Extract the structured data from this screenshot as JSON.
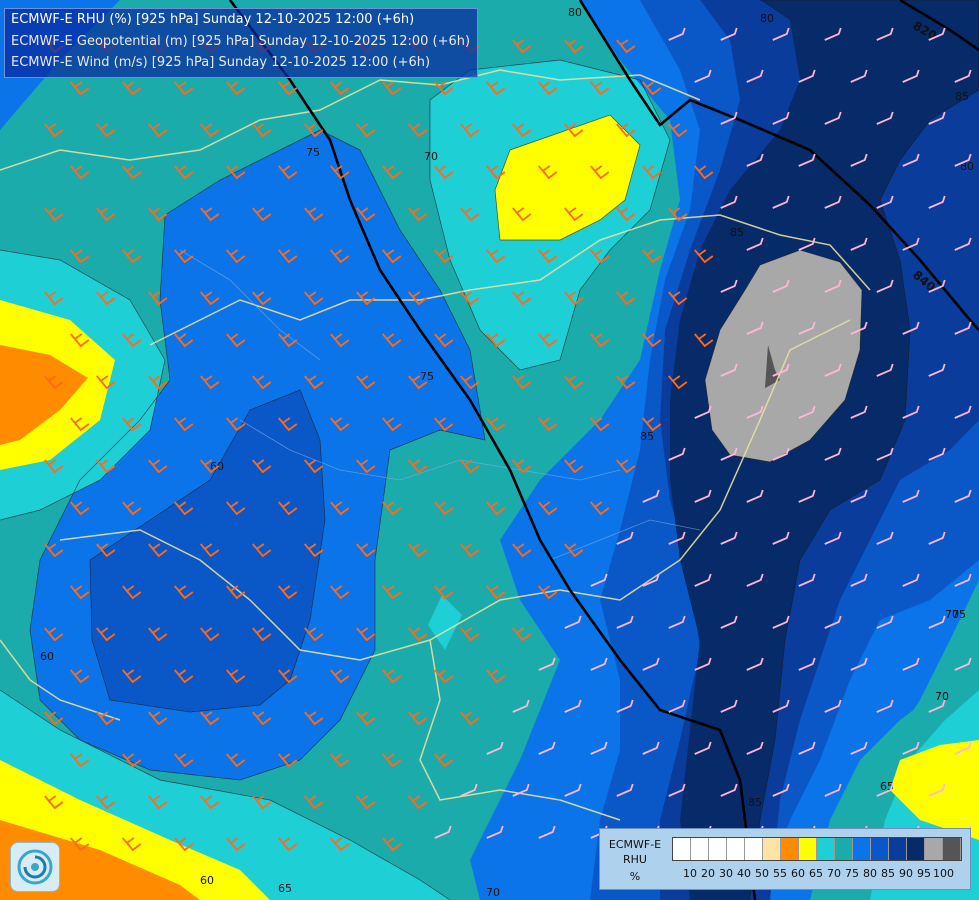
{
  "titles": [
    "ECMWF-E RHU (%) [925 hPa] Sunday 12-10-2025 12:00 (+6h)",
    "ECMWF-E Geopotential (m) [925 hPa] Sunday 12-10-2025 12:00 (+6h)",
    "ECMWF-E Wind (m/s) [925 hPa] Sunday 12-10-2025 12:00 (+6h)"
  ],
  "legend": {
    "title_lines": [
      "ECMWF-E",
      "RHU",
      "%"
    ],
    "colors": [
      "#ffffff",
      "#ffffff",
      "#ffffff",
      "#ffffff",
      "#ffffff",
      "#fde3a4",
      "#ff8c00",
      "#ffff00",
      "#1fcfd6",
      "#1aabaa",
      "#0a74e8",
      "#0a58c8",
      "#0a3c9c",
      "#072a68",
      "#a8a8a8",
      "#555555"
    ],
    "ticks": [
      "10",
      "20",
      "30",
      "40",
      "50",
      "55",
      "60",
      "65",
      "70",
      "75",
      "80",
      "85",
      "90",
      "95",
      "100"
    ]
  },
  "contour_labels": [
    "80",
    "80",
    "85",
    "75",
    "70",
    "70",
    "80",
    "85",
    "60",
    "60",
    "75",
    "70",
    "65",
    "60",
    "65",
    "70",
    "85",
    "85",
    "75"
  ],
  "geopotential_labels": [
    "820",
    "840"
  ],
  "colors": {
    "rh_55": "#fde3a4",
    "rh_60": "#ff8c00",
    "rh_65": "#ffff00",
    "rh_70": "#1fcfd6",
    "rh_75": "#1aabaa",
    "rh_80": "#0a74e8",
    "rh_85": "#0a58c8",
    "rh_90": "#0a3c9c",
    "rh_95": "#072a68",
    "rh_100": "#a8a8a8",
    "barb_strong": "#ff6a1a",
    "barb_weak": "#ffb6d9",
    "border_line": "#e8e0a0"
  },
  "icons": {
    "logo": "ecmwf-logo-icon"
  }
}
